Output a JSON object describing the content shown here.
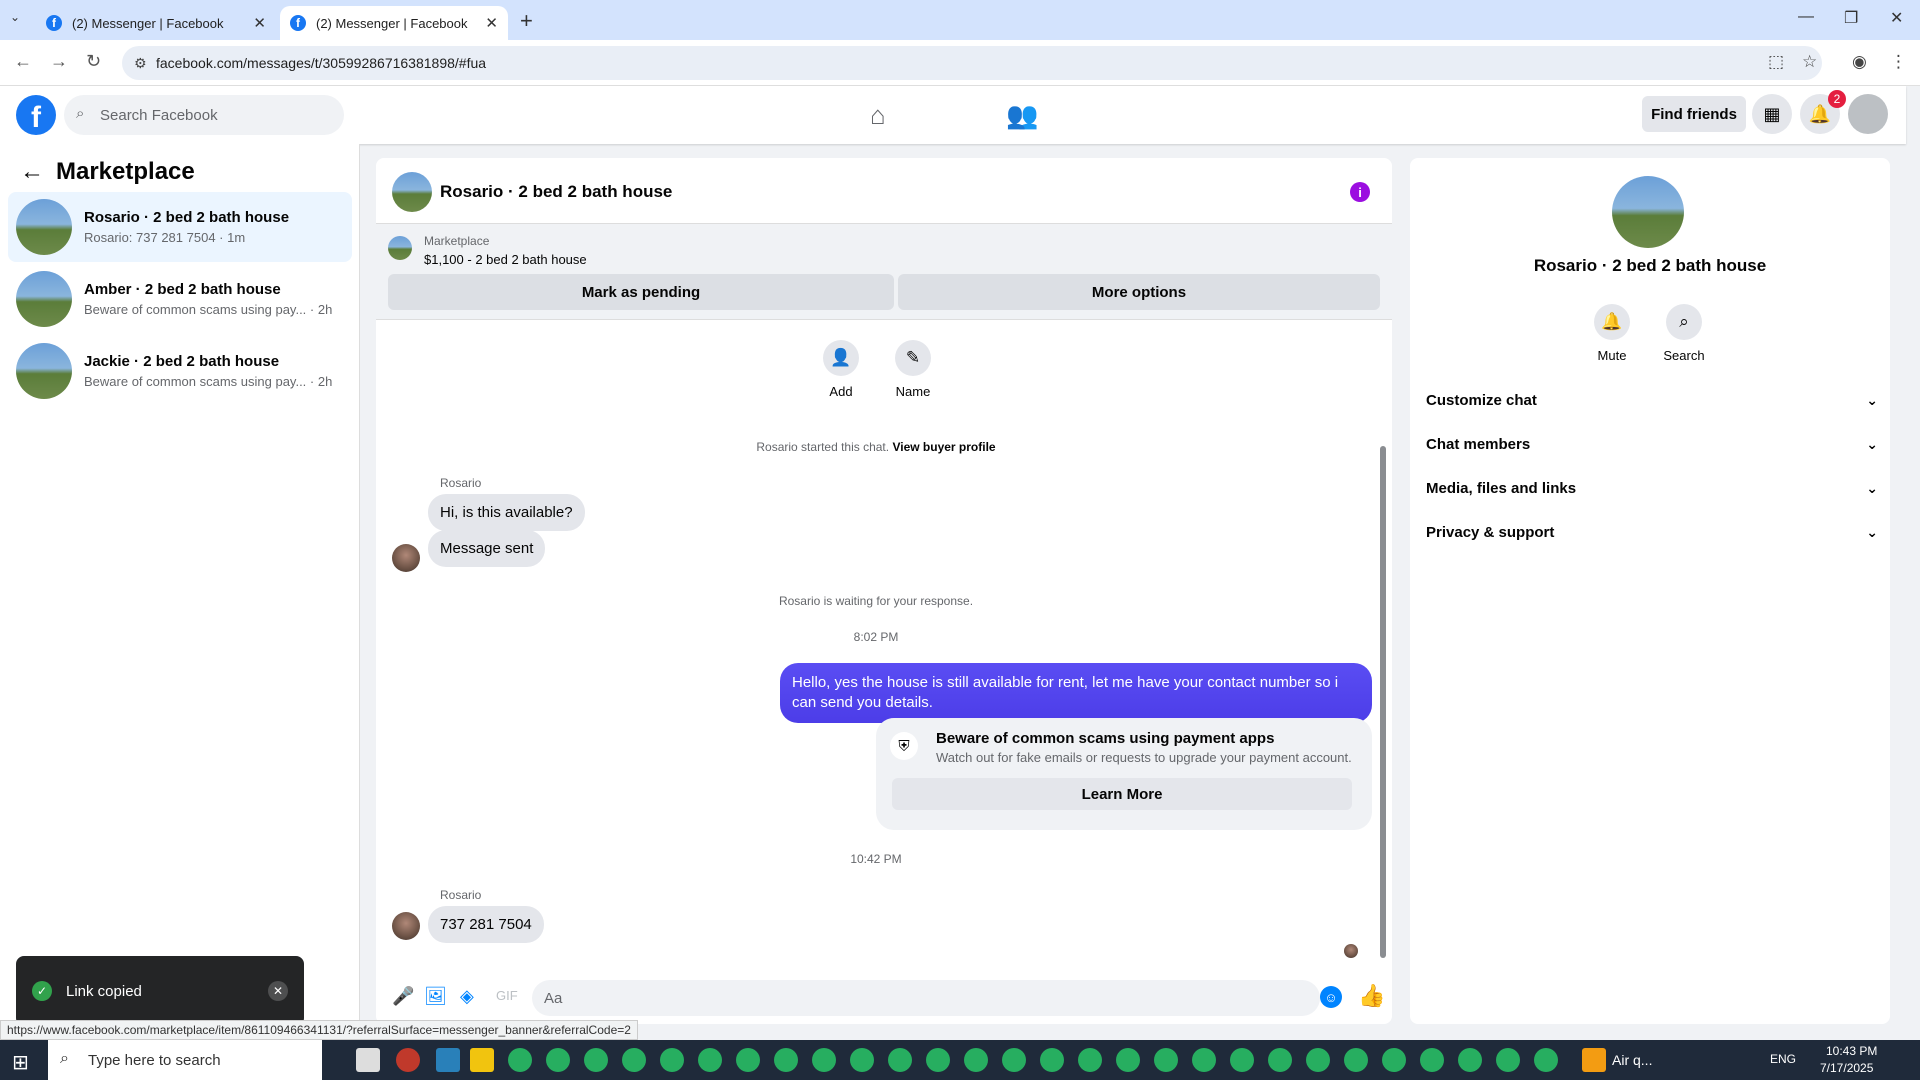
{
  "browser": {
    "tabs": [
      {
        "title": "(2) Messenger | Facebook"
      },
      {
        "title": "(2) Messenger | Facebook"
      }
    ],
    "url": "facebook.com/messages/t/30599286716381898/#fua"
  },
  "fb_header": {
    "search_placeholder": "Search Facebook",
    "find_friends": "Find friends",
    "notification_count": "2"
  },
  "sidebar": {
    "title": "Marketplace",
    "conversations": [
      {
        "title": "Rosario · 2 bed 2 bath house",
        "subtitle": "Rosario: 737 281 7504 · 1m"
      },
      {
        "title": "Amber · 2 bed 2 bath house",
        "subtitle": "Beware of common scams using pay... · 2h"
      },
      {
        "title": "Jackie · 2 bed 2 bath house",
        "subtitle": "Beware of common scams using pay... · 2h"
      }
    ]
  },
  "chat": {
    "title": "Rosario · 2 bed 2 bath house",
    "listing": {
      "kicker": "Marketplace",
      "price_line": "$1,100 - 2 bed 2 bath house",
      "mark_pending": "Mark as pending",
      "more_options": "More options"
    },
    "actions": {
      "add": "Add",
      "name": "Name"
    },
    "started_text": "Rosario started this chat.",
    "view_buyer_profile": "View buyer profile",
    "sender_name": "Rosario",
    "msg1": "Hi, is this available?",
    "msg2": "Message sent",
    "waiting_text": "Rosario is waiting for your response.",
    "time1": "8:02 PM",
    "outgoing": "Hello, yes the house is still available for rent, let me have your contact number so i can send you details.",
    "scam": {
      "title": "Beware of common scams using payment apps",
      "desc": "Watch out for fake emails or requests to upgrade your payment account.",
      "learn_more": "Learn More"
    },
    "time2": "10:42 PM",
    "sender_name2": "Rosario",
    "msg3": "737 281 7504",
    "composer_placeholder": "Aa"
  },
  "info_panel": {
    "title": "Rosario · 2 bed 2 bath house",
    "mute": "Mute",
    "search": "Search",
    "sections": [
      "Customize chat",
      "Chat members",
      "Media, files and links",
      "Privacy & support"
    ]
  },
  "toast": {
    "text": "Link copied"
  },
  "status_url": "https://www.facebook.com/marketplace/item/861109466341131/?referralSurface=messenger_banner&referralCode=2",
  "taskbar": {
    "search_placeholder": "Type here to search",
    "weather": "Air q...",
    "lang": "ENG",
    "time": "10:43 PM",
    "date": "7/17/2025"
  }
}
